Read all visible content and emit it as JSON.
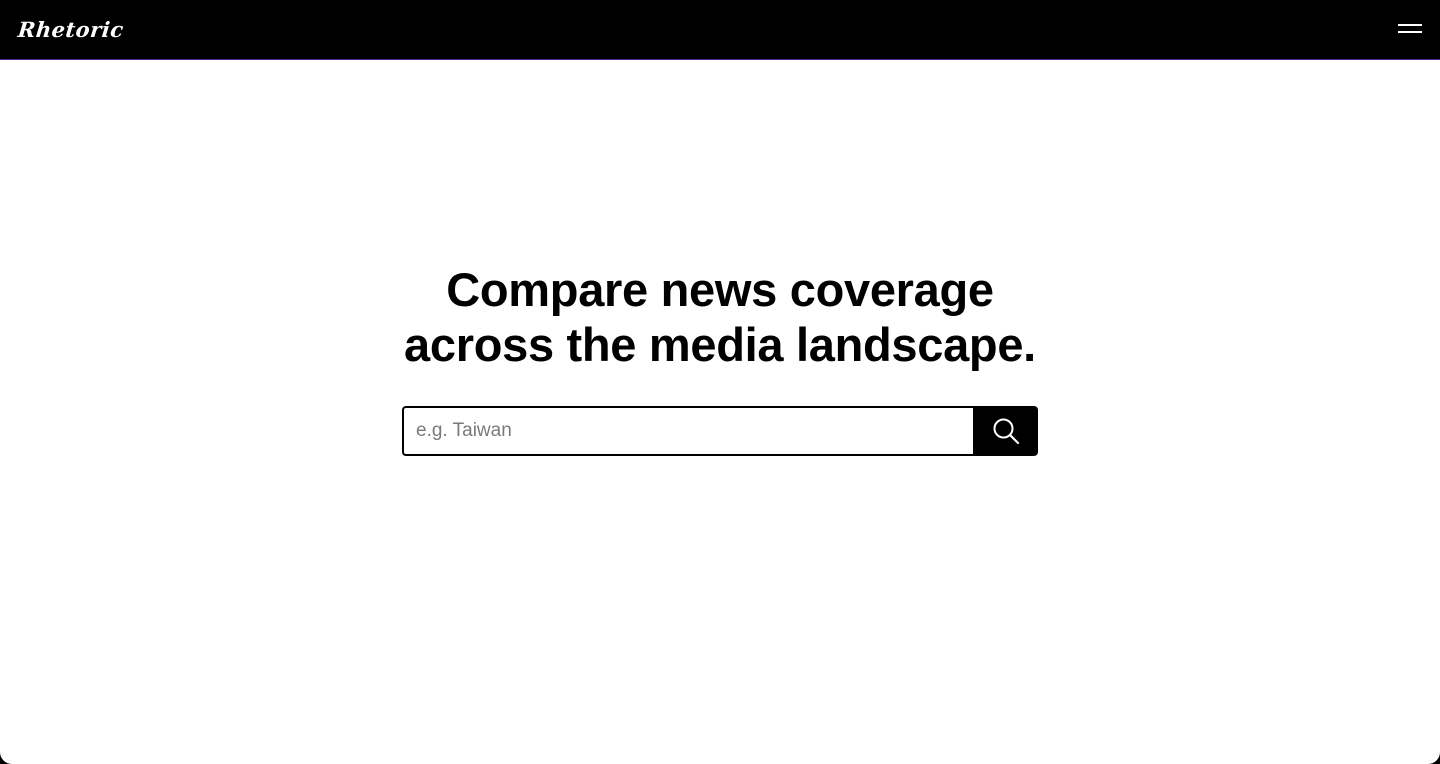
{
  "header": {
    "brand": "Rhetoric",
    "menu_icon": "hamburger-menu-icon"
  },
  "hero": {
    "headline_line1": "Compare news coverage",
    "headline_line2": "across the media landscape."
  },
  "search": {
    "placeholder": "e.g. Taiwan",
    "value": "",
    "button_icon": "search-icon"
  },
  "colors": {
    "topbar": "#000000",
    "topbar_border": "#5b2a86",
    "page_background": "#ffffff",
    "text": "#000000",
    "placeholder": "#7a7a7a"
  }
}
